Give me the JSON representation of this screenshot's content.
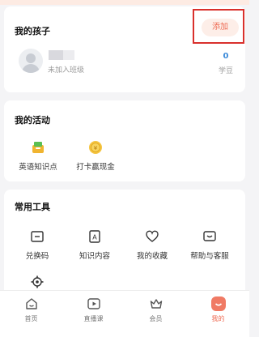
{
  "kids": {
    "title": "我的孩子",
    "add_label": "添加",
    "status": "未加入班级",
    "beans_value": "0",
    "beans_label": "学豆"
  },
  "activities": {
    "title": "我的活动",
    "items": [
      {
        "label": "英语知识点",
        "icon": "book-basket-icon"
      },
      {
        "label": "打卡赢现金",
        "icon": "coin-icon"
      }
    ]
  },
  "tools": {
    "title": "常用工具",
    "items": [
      {
        "label": "兑换码",
        "icon": "ticket-icon"
      },
      {
        "label": "知识内容",
        "icon": "document-icon"
      },
      {
        "label": "我的收藏",
        "icon": "heart-icon"
      },
      {
        "label": "帮助与客服",
        "icon": "chat-icon"
      },
      {
        "label": "",
        "icon": "gear-icon"
      }
    ]
  },
  "nav": {
    "items": [
      {
        "label": "首页",
        "icon": "home-icon"
      },
      {
        "label": "直播课",
        "icon": "play-icon"
      },
      {
        "label": "会员",
        "icon": "crown-icon"
      },
      {
        "label": "我的",
        "icon": "mine-icon",
        "active": true
      }
    ]
  },
  "colors": {
    "accent": "#ee6a52",
    "highlight": "#d9302c",
    "beans": "#3b8ad9"
  }
}
